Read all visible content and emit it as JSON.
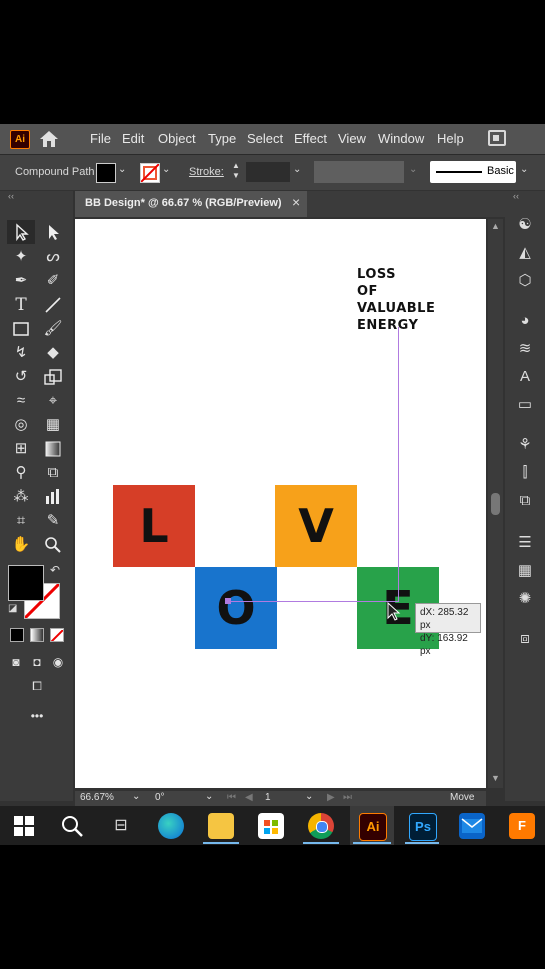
{
  "menubar": {
    "app_badge": "Ai",
    "items": [
      "File",
      "Edit",
      "Object",
      "Type",
      "Select",
      "Effect",
      "View",
      "Window",
      "Help"
    ]
  },
  "controlbar": {
    "selection_type": "Compound Path",
    "stroke_label": "Stroke:",
    "brush_label": "Basic"
  },
  "document_tab": {
    "title": "BB Design* @ 66.67 % (RGB/Preview)",
    "close_glyph": "×"
  },
  "artwork": {
    "heading_lines": [
      "LOSS",
      "OF",
      "VALUABLE",
      "ENERGY"
    ],
    "tiles": [
      {
        "letter": "L",
        "color": "#d63e27"
      },
      {
        "letter": "O",
        "color": "#1874cd"
      },
      {
        "letter": "V",
        "color": "#f7a11a"
      },
      {
        "letter": "E",
        "color": "#28a24a"
      }
    ],
    "measure_dx": "dX: 285.32 px",
    "measure_dy": "dY: 163.92 px"
  },
  "statusbar": {
    "zoom": "66.67%",
    "rotation": "0°",
    "artboard_number": "1",
    "tool_status": "Move"
  },
  "taskbar": {
    "ai_label": "Ai",
    "ps_label": "Ps"
  },
  "colors": {
    "app_bg": "#323232",
    "menubar_bg": "#535353",
    "taskbar_bg": "#1f1f1f",
    "guide": "#b07be0"
  }
}
